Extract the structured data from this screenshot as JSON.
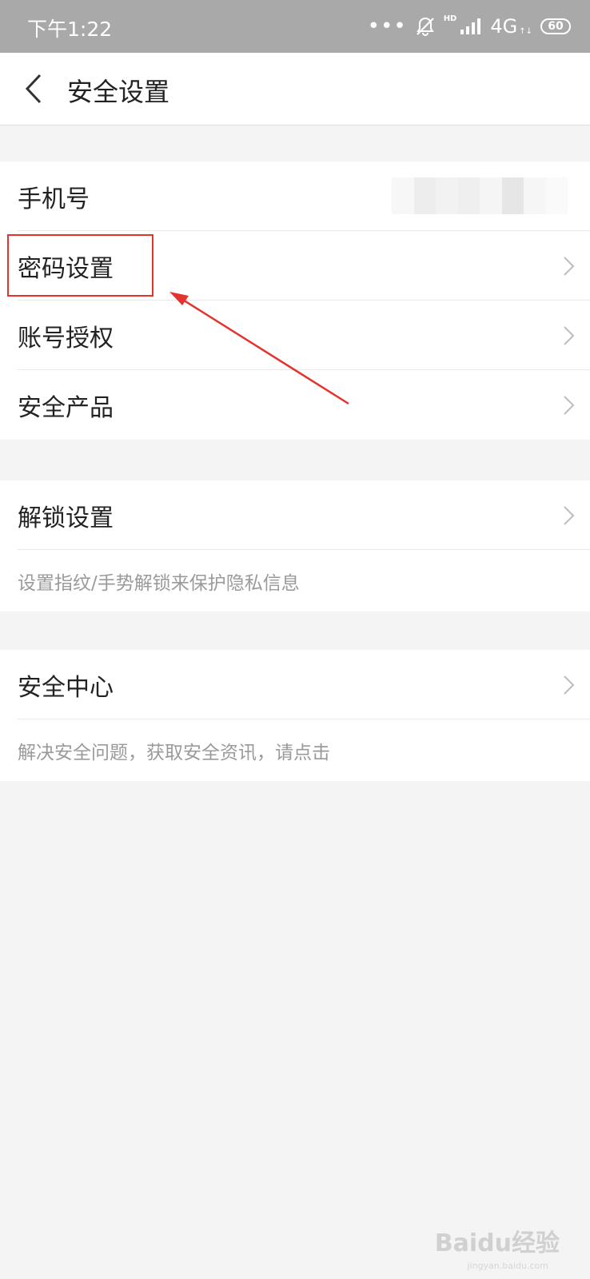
{
  "status_bar": {
    "time": "下午1:22",
    "dots": "•••",
    "hd": "HD",
    "network": "4G",
    "battery": "60"
  },
  "nav": {
    "title": "安全设置"
  },
  "groups": [
    {
      "items": [
        {
          "label": "手机号"
        },
        {
          "label": "密码设置"
        },
        {
          "label": "账号授权"
        },
        {
          "label": "安全产品"
        }
      ]
    },
    {
      "items": [
        {
          "label": "解锁设置"
        }
      ],
      "description": "设置指纹/手势解锁来保护隐私信息"
    },
    {
      "items": [
        {
          "label": "安全中心"
        }
      ],
      "description": "解决安全问题，获取安全资讯，请点击"
    }
  ],
  "watermark": {
    "brand": "Baidu经验",
    "url": "jingyan.baidu.com"
  },
  "colors": {
    "status_bar": "#a9a9a9",
    "annotation_red": "#e5322d",
    "background": "#f4f4f4"
  }
}
